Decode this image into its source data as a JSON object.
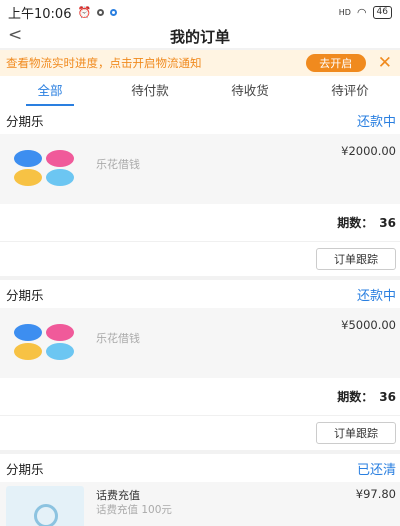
{
  "statusbar": {
    "time": "上午10:06",
    "signal": "HD",
    "battery": "46"
  },
  "navbar": {
    "back": "<",
    "title": "我的订单"
  },
  "banner": {
    "text": "查看物流实时进度，点击开启物流通知",
    "button": "去开启",
    "close": "✕"
  },
  "tabs": [
    {
      "label": "全部",
      "active": true
    },
    {
      "label": "待付款",
      "active": false
    },
    {
      "label": "待收货",
      "active": false
    },
    {
      "label": "待评价",
      "active": false
    }
  ],
  "orders": [
    {
      "merchant": "分期乐",
      "status": "还款中",
      "product": "乐花借钱",
      "price": "¥2000.00",
      "periods_label": "期数：",
      "periods": "36",
      "action": "订单跟踪"
    },
    {
      "merchant": "分期乐",
      "status": "还款中",
      "product": "乐花借钱",
      "price": "¥5000.00",
      "periods_label": "期数：",
      "periods": "36",
      "action": "订单跟踪"
    },
    {
      "merchant": "分期乐",
      "status": "已还清",
      "product": "话费充值",
      "product_sub": "话费充值 100元",
      "price": "¥97.80"
    }
  ],
  "colors": {
    "accent": "#2a7fe0",
    "banner": "#f08a1e",
    "petal_blue": "#3d8ef0",
    "petal_pink": "#f05a9a",
    "petal_yellow": "#f7c244",
    "petal_cyan": "#6cc6f2"
  }
}
